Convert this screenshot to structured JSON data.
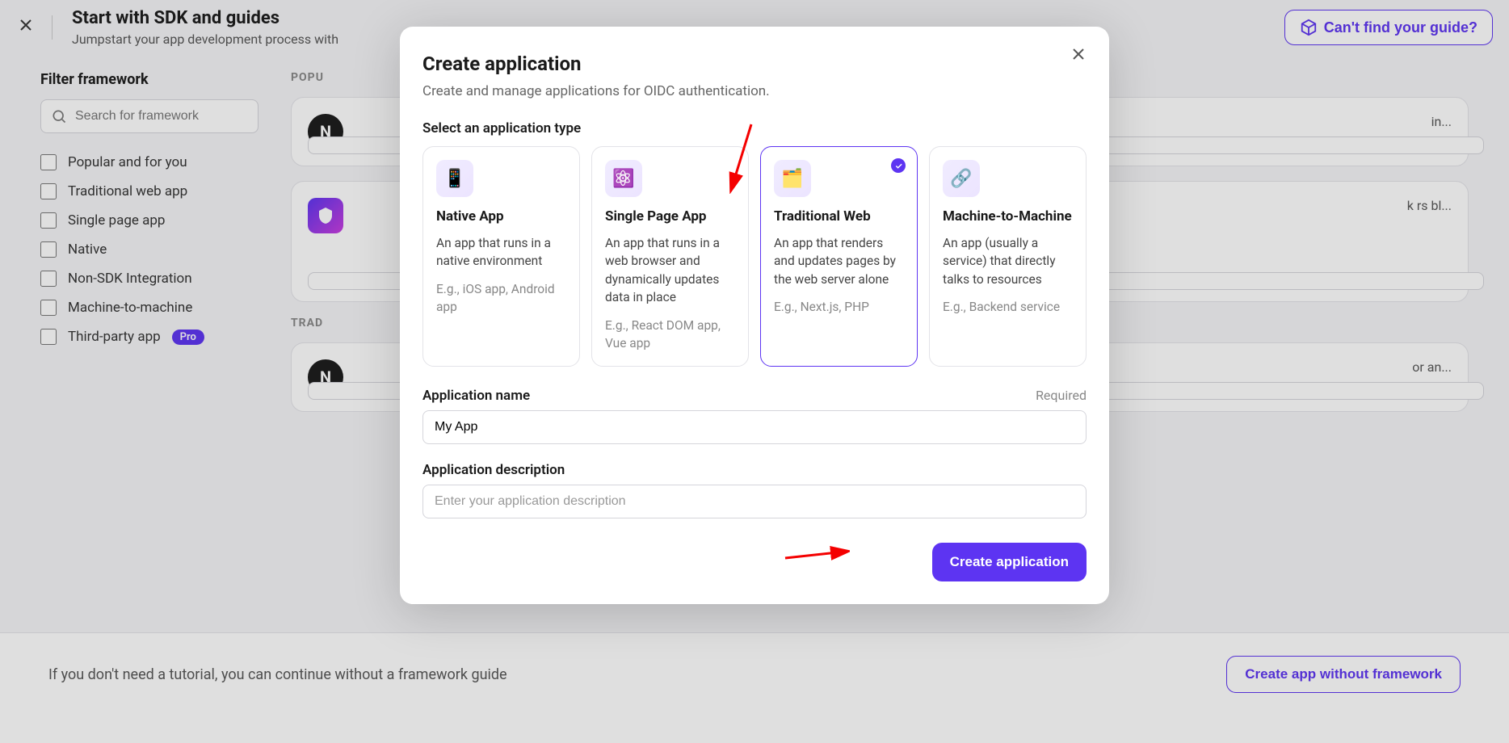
{
  "header": {
    "title": "Start with SDK and guides",
    "subtitle": "Jumpstart your app development process with",
    "guide_button": "Can't find your guide?"
  },
  "sidebar": {
    "title": "Filter framework",
    "search_placeholder": "Search for framework",
    "filters": [
      {
        "label": "Popular and for you"
      },
      {
        "label": "Traditional web app"
      },
      {
        "label": "Single page app"
      },
      {
        "label": "Native"
      },
      {
        "label": "Non-SDK Integration"
      },
      {
        "label": "Machine-to-machine"
      },
      {
        "label": "Third-party app",
        "badge": "Pro"
      }
    ]
  },
  "main": {
    "sections": [
      {
        "label": "POPU",
        "cards": [
          {
            "icon_letter": "N",
            "right_text": "in..."
          },
          {
            "icon_type": "shield",
            "right_text": "k rs bl..."
          }
        ]
      },
      {
        "label": "TRAD",
        "cards": [
          {
            "icon_letter": "N",
            "right_text": "or an..."
          }
        ]
      }
    ]
  },
  "footer": {
    "text": "If you don't need a tutorial, you can continue without a framework guide",
    "button": "Create app without framework"
  },
  "modal": {
    "title": "Create application",
    "subtitle": "Create and manage applications for OIDC authentication.",
    "select_type_label": "Select an application type",
    "types": [
      {
        "title": "Native App",
        "desc": "An app that runs in a native environment",
        "eg": "E.g., iOS app, Android app",
        "selected": false,
        "icon": "native"
      },
      {
        "title": "Single Page App",
        "desc": "An app that runs in a web browser and dynamically updates data in place",
        "eg": "E.g., React DOM app, Vue app",
        "selected": false,
        "icon": "spa"
      },
      {
        "title": "Traditional Web",
        "desc": "An app that renders and updates pages by the web server alone",
        "eg": "E.g., Next.js, PHP",
        "selected": true,
        "icon": "web"
      },
      {
        "title": "Machine-to-Machine",
        "desc": "An app (usually a service) that directly talks to resources",
        "eg": "E.g., Backend service",
        "selected": false,
        "icon": "m2m"
      }
    ],
    "app_name_label": "Application name",
    "required_label": "Required",
    "app_name_value": "My App",
    "app_desc_label": "Application description",
    "app_desc_placeholder": "Enter your application description",
    "submit": "Create application"
  },
  "colors": {
    "primary": "#5d34f2",
    "annotation": "#f40000"
  }
}
